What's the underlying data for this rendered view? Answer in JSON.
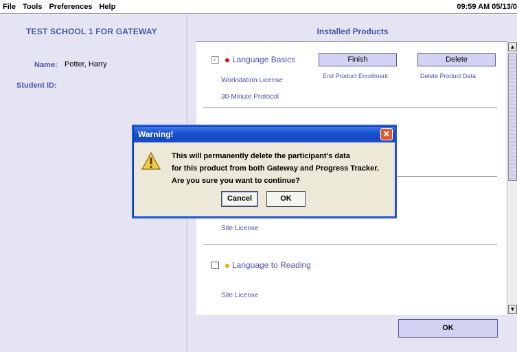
{
  "menu": {
    "file": "File",
    "tools": "Tools",
    "preferences": "Preferences",
    "help": "Help",
    "clock": "09:59 AM 05/13/0"
  },
  "left": {
    "school_title": "TEST SCHOOL 1 FOR GATEWAY",
    "name_label": "Name:",
    "name_value": "Potter, Harry",
    "student_id_label": "Student ID:"
  },
  "right": {
    "installed_title": "Installed Products",
    "products": [
      {
        "name": "Language Basics",
        "checked": true,
        "dot_color": "#cc1a1a",
        "license": "Workstation License",
        "protocol": "30-Minute Protocol",
        "finish_label": "Finish",
        "finish_caption": "End Product Enrollment",
        "delete_label": "Delete",
        "delete_caption": "Delete Product Data"
      },
      {
        "license": "Site License"
      },
      {
        "name": "Language to Reading",
        "checked": false,
        "dot_color": "#f0a800",
        "license": "Site License"
      }
    ],
    "ok_label": "OK"
  },
  "dialog": {
    "title": "Warning!",
    "close_glyph": "✕",
    "lines": [
      "This will permanently delete the participant's data",
      "for this product from both Gateway and Progress Tracker.",
      "Are you sure you want to continue?"
    ],
    "cancel_label": "Cancel",
    "ok_label": "OK"
  },
  "colors": {
    "accent": "#4a55a8",
    "panel_bg": "#e4e4f2",
    "button_bg": "#d2d2f2",
    "dialog_title": "#1a52d0"
  },
  "icons": {
    "warning": "warning-icon",
    "close": "close-icon",
    "checkbox_checked": "check-icon",
    "scroll_up": "arrow-up-icon",
    "scroll_down": "arrow-down-icon"
  }
}
